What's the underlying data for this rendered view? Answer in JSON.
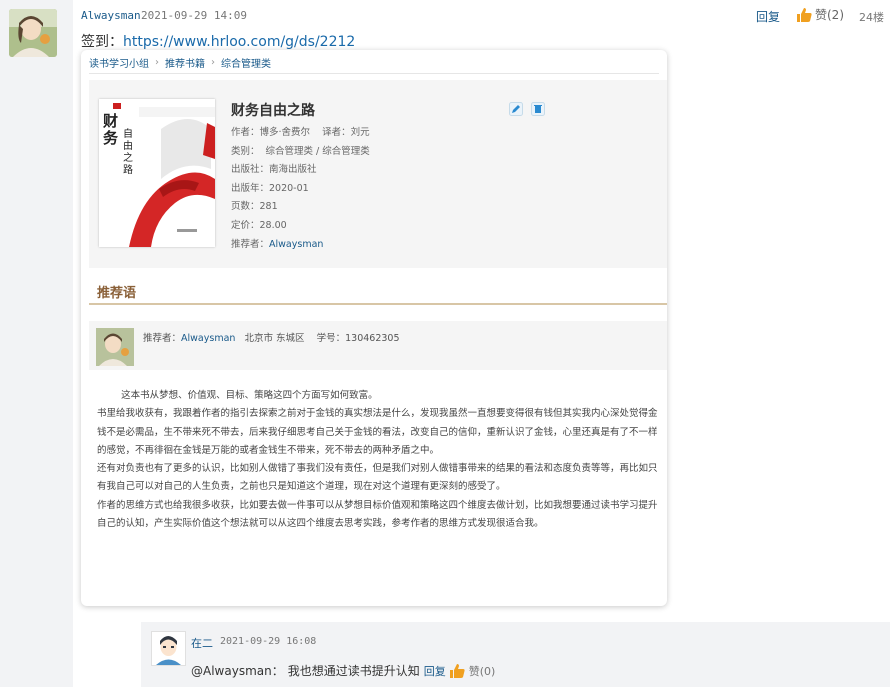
{
  "post": {
    "author": "Alwaysman",
    "time": "2021-09-29 14:09",
    "reply_label": "回复",
    "like_label": "赞(2)",
    "floor": "24楼",
    "signin_prefix": "签到：",
    "signin_url": "https://www.hrloo.com/g/ds/2212"
  },
  "card": {
    "breadcrumb": [
      "读书学习小组",
      "推荐书籍",
      "综合管理类"
    ],
    "book": {
      "title": "财务自由之路",
      "author_line": "作者：博多·舍费尔    译者：刘元",
      "category_line": "类别：  综合管理类 / 综合管理类",
      "publisher_line": "出版社：南海出版社",
      "year_line": "出版年：2020-01",
      "pages_line": "页数：281",
      "price_line": "定价：28.00",
      "recommender_prefix": "推荐者：",
      "recommender": "Alwaysman",
      "cover_title": "财务",
      "cover_subtitle": "自由之路"
    },
    "rec_heading": "推荐语",
    "recommender_info": {
      "prefix": "推荐者：",
      "name": "Alwaysman",
      "location": "北京市 东城区",
      "id_line": "学号：130462305"
    },
    "paragraphs": [
      "        这本书从梦想、价值观、目标、策略这四个方面写如何致富。",
      "书里给我收获有，我跟着作者的指引去探索之前对于金钱的真实想法是什么，发现我虽然一直想要变得很有钱但其实我内心深处觉得金钱不是必需品，生不带来死不带去，后来我仔细思考自己关于金钱的看法，改变自己的信仰，重新认识了金钱，心里还真是有了不一样的感觉，不再徘徊在金钱是万能的或者金钱生不带来，死不带去的两种矛盾之中。",
      "还有对负责也有了更多的认识，比如别人做错了事我们没有责任，但是我们对别人做错事带来的结果的看法和态度负责等等，再比如只有我自己可以对自己的人生负责，之前也只是知道这个道理，现在对这个道理有更深刻的感受了。",
      "作者的思维方式也给我很多收获，比如要去做一件事可以从梦想目标价值观和策略这四个维度去做计划，比如我想要通过读书学习提升自己的认知，产生实际价值这个想法就可以从这四个维度去思考实践，参考作者的思维方式发现很适合我。"
    ]
  },
  "reply": {
    "author": "在二",
    "time": "2021-09-29 16:08",
    "mention": "@Alwaysman：",
    "text": "我也想通过读书提升认知",
    "reply_label": "回复",
    "like_label": "赞(0)"
  },
  "colors": {
    "link": "#1a5a8a",
    "heading": "#8a6038",
    "like": "#f0a020"
  }
}
